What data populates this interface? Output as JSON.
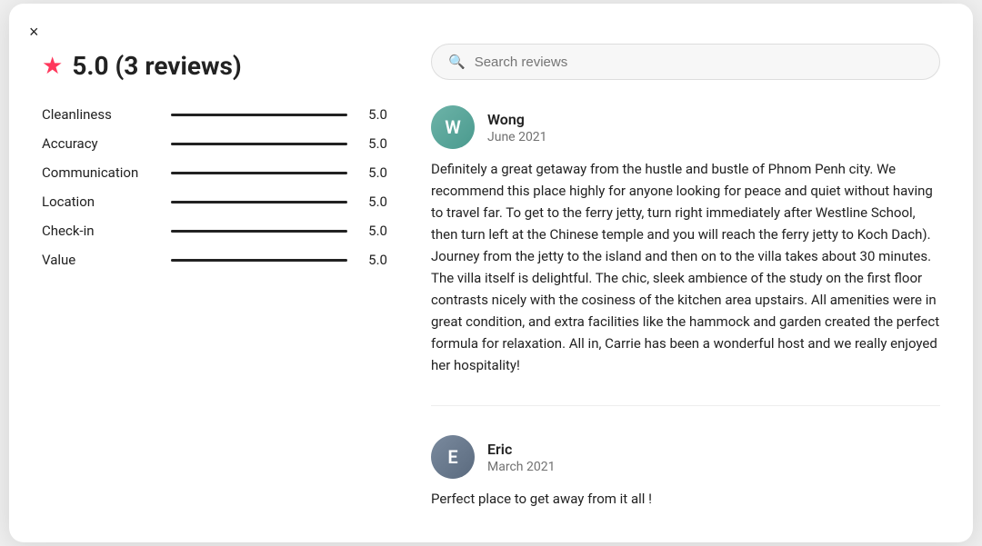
{
  "modal": {
    "close_label": "×"
  },
  "rating": {
    "score": "5.0",
    "reviews_label": "5.0 (3 reviews)"
  },
  "categories": [
    {
      "label": "Cleanliness",
      "score": "5.0"
    },
    {
      "label": "Accuracy",
      "score": "5.0"
    },
    {
      "label": "Communication",
      "score": "5.0"
    },
    {
      "label": "Location",
      "score": "5.0"
    },
    {
      "label": "Check-in",
      "score": "5.0"
    },
    {
      "label": "Value",
      "score": "5.0"
    }
  ],
  "search": {
    "placeholder": "Search reviews"
  },
  "reviews": [
    {
      "name": "Wong",
      "date": "June 2021",
      "avatar_initial": "W",
      "avatar_class": "avatar-wong",
      "text": "Definitely a great getaway from the hustle and bustle of Phnom Penh city. We recommend this place highly for anyone looking for peace and quiet without having to travel far. To get to the ferry jetty, turn right immediately after Westline School, then turn left at the Chinese temple and you will reach the ferry jetty to Koch Dach). Journey from the jetty to the island and then on to the villa takes about 30 minutes. The villa itself is delightful. The chic, sleek ambience of the study on the first floor contrasts nicely with the cosiness of the kitchen area upstairs. All amenities were in great condition, and extra facilities like the hammock and garden created the perfect formula for relaxation. All in, Carrie has been a wonderful host and we really enjoyed her hospitality!"
    },
    {
      "name": "Eric",
      "date": "March 2021",
      "avatar_initial": "E",
      "avatar_class": "avatar-eric",
      "text": "Perfect place to get away from it all !"
    }
  ]
}
